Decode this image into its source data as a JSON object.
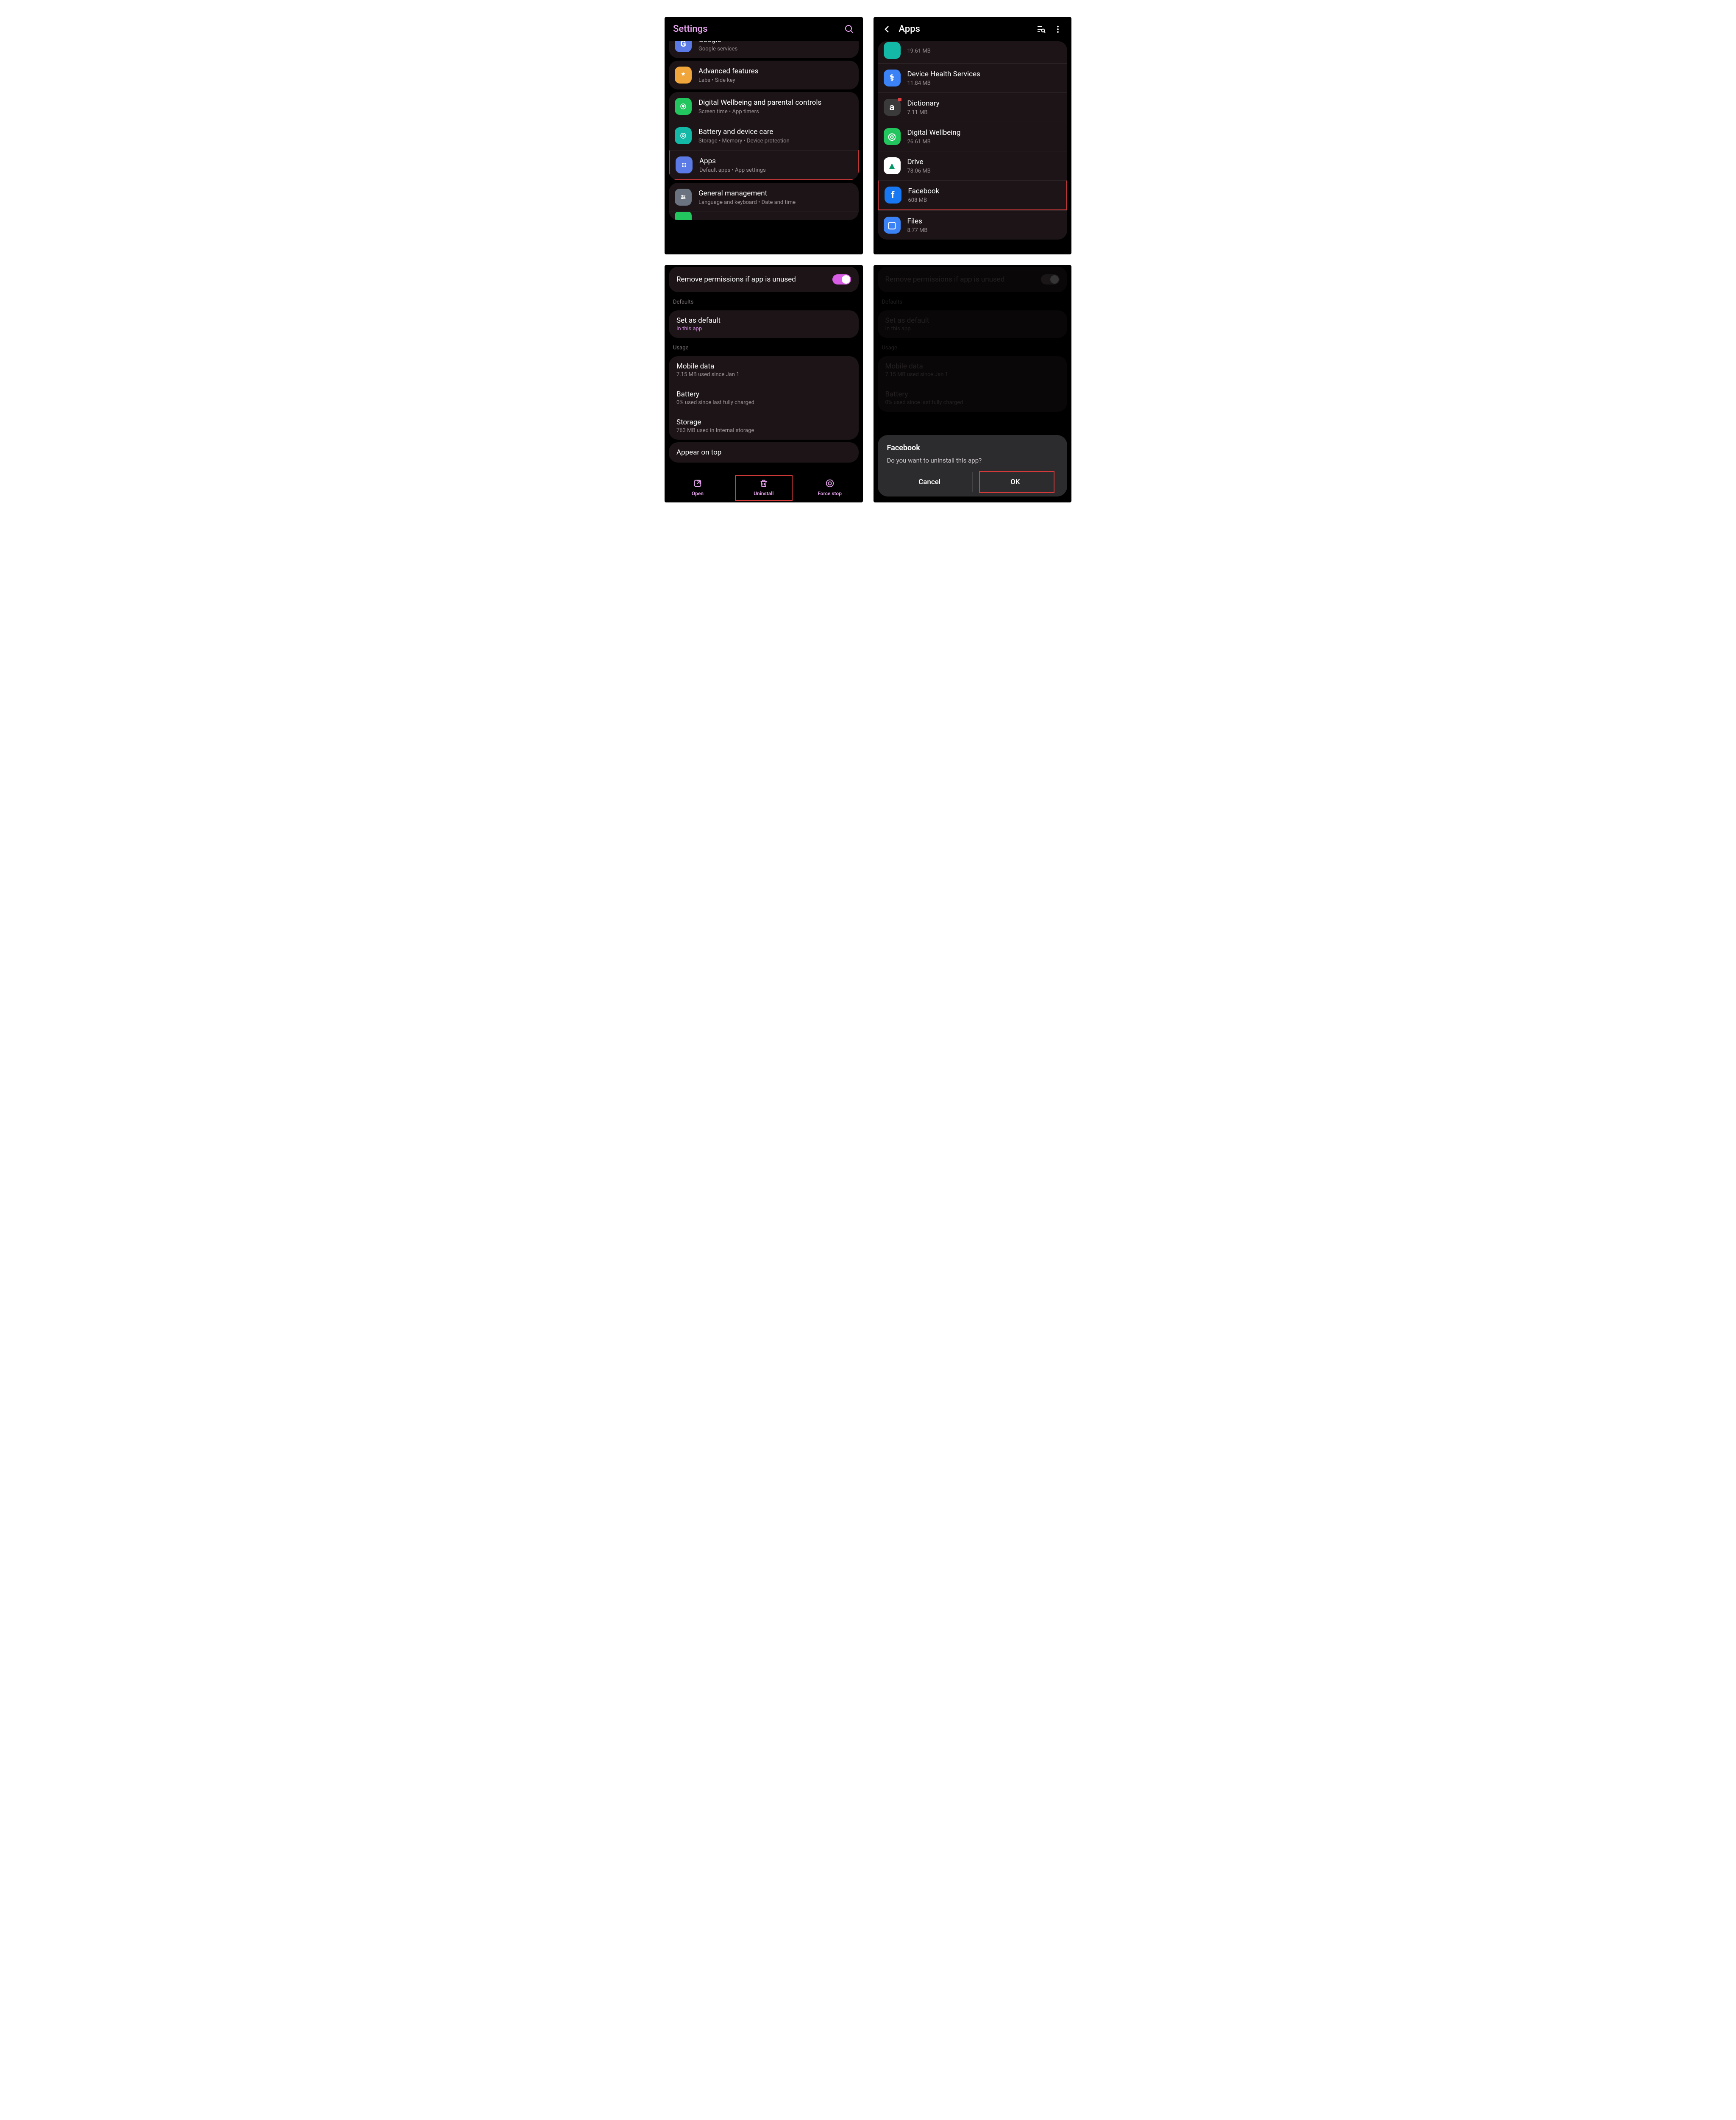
{
  "s1": {
    "title": "Settings",
    "items_top": [
      {
        "title": "Google",
        "sub": "Google services"
      }
    ],
    "group_adv": [
      {
        "title": "Advanced features",
        "sub": "Labs  •  Side key"
      }
    ],
    "group_care": [
      {
        "title": "Digital Wellbeing and parental controls",
        "sub": "Screen time  •  App timers"
      },
      {
        "title": "Battery and device care",
        "sub": "Storage  •  Memory  •  Device protection"
      },
      {
        "title": "Apps",
        "sub": "Default apps  •  App settings"
      }
    ],
    "group_mgmt": [
      {
        "title": "General management",
        "sub": "Language and keyboard  •  Date and time"
      }
    ]
  },
  "s2": {
    "title": "Apps",
    "apps": [
      {
        "name": "",
        "size": "19.61 MB",
        "bg": "#14b8a6",
        "letter": ""
      },
      {
        "name": "Device Health Services",
        "size": "11.84 MB",
        "bg": "#3b82f6",
        "letter": "⚕"
      },
      {
        "name": "Dictionary",
        "size": "7.11 MB",
        "bg": "#3a3a3a",
        "letter": "a",
        "badge": true
      },
      {
        "name": "Digital Wellbeing",
        "size": "26.61 MB",
        "bg": "#22c55e",
        "letter": "◎"
      },
      {
        "name": "Drive",
        "size": "78.06 MB",
        "bg": "#ffffff",
        "letter": "▲",
        "fg": "#059669"
      },
      {
        "name": "Facebook",
        "size": "608 MB",
        "bg": "#1877f2",
        "letter": "f",
        "highlight": true
      },
      {
        "name": "Files",
        "size": "8.77 MB",
        "bg": "#3b82f6",
        "letter": "▢"
      }
    ]
  },
  "s3": {
    "remove_perm": "Remove permissions if app is unused",
    "defaults_label": "Defaults",
    "set_default": "Set as default",
    "in_this_app": "In this app",
    "usage_label": "Usage",
    "usage": [
      {
        "title": "Mobile data",
        "sub": "7.15 MB used since Jan 1"
      },
      {
        "title": "Battery",
        "sub": "0% used since last fully charged"
      },
      {
        "title": "Storage",
        "sub": "763 MB used in Internal storage"
      }
    ],
    "appear": "Appear on top",
    "bottom": {
      "open": "Open",
      "uninstall": "Uninstall",
      "force": "Force stop"
    }
  },
  "s4": {
    "remove_perm": "Remove permissions if app is unused",
    "defaults_label": "Defaults",
    "set_default": "Set as default",
    "in_this_app": "In this app",
    "usage_label": "Usage",
    "usage": [
      {
        "title": "Mobile data",
        "sub": "7.15 MB used since Jan 1"
      },
      {
        "title": "Battery",
        "sub": "0% used since last fully charged"
      }
    ],
    "dialog": {
      "title": "Facebook",
      "msg": "Do you want to uninstall this app?",
      "cancel": "Cancel",
      "ok": "OK"
    }
  }
}
